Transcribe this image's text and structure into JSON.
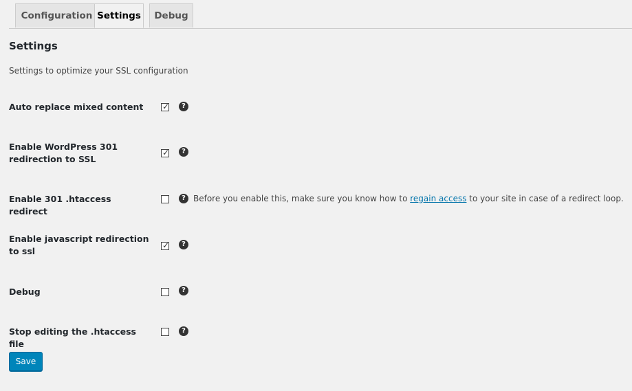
{
  "tabs": [
    {
      "label": "Configuration",
      "active": false
    },
    {
      "label": "Settings",
      "active": true
    },
    {
      "label": "Debug",
      "active": false
    }
  ],
  "page": {
    "title": "Settings",
    "subtitle": "Settings to optimize your SSL configuration"
  },
  "settings": [
    {
      "label": "Auto replace mixed content",
      "checked": true
    },
    {
      "label": "Enable WordPress 301 redirection to SSL",
      "checked": true
    },
    {
      "label": "Enable 301 .htaccess redirect",
      "checked": false
    },
    {
      "label": "Enable javascript redirection to ssl",
      "checked": true
    },
    {
      "label": "Debug",
      "checked": false
    },
    {
      "label": "Stop editing the .htaccess file",
      "checked": false
    }
  ],
  "htaccess_note": {
    "before": "Before you enable this, make sure you know how to ",
    "link": "regain access",
    "after": " to your site in case of a redirect loop."
  },
  "icons": {
    "help": "question-mark-circle-icon",
    "check": "checkmark-icon"
  },
  "help_glyph": "?",
  "check_glyph": "✓",
  "save_label": "Save",
  "colors": {
    "background": "#f1f1f1",
    "primary_button": "#0085ba",
    "link": "#0073aa"
  }
}
